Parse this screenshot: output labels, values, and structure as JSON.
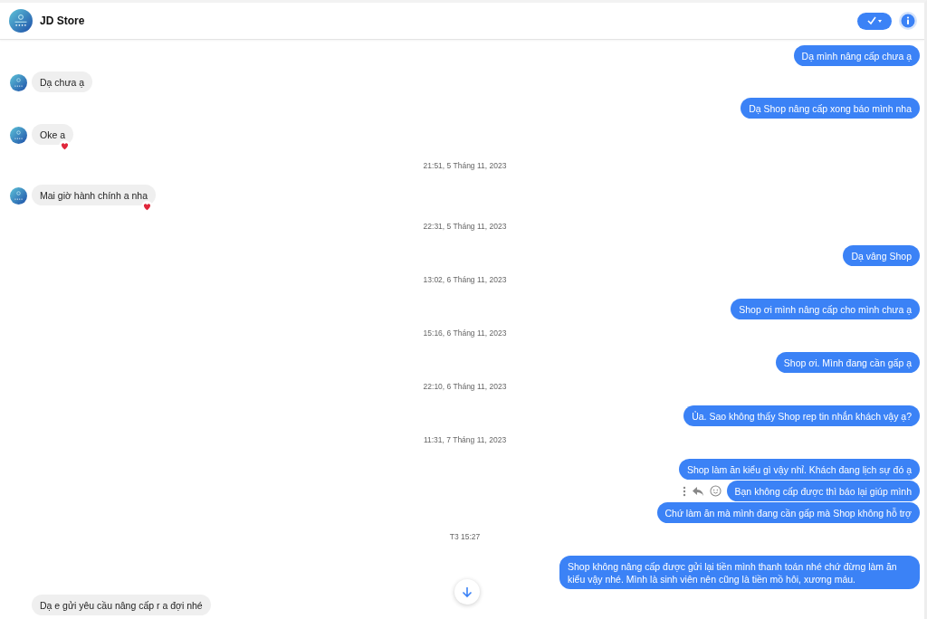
{
  "header": {
    "title": "JD Store"
  },
  "messages": [
    {
      "kind": "outgoing",
      "text": "Dạ mình nâng cấp chưa ạ"
    },
    {
      "kind": "incoming",
      "text": "Dạ chưa ạ",
      "avatar": true,
      "reacted": false
    },
    {
      "kind": "outgoing",
      "text": "Dạ Shop nâng cấp xong báo mình nha"
    },
    {
      "kind": "incoming",
      "text": "Oke a",
      "avatar": true,
      "reacted": true
    },
    {
      "kind": "time",
      "text": "21:51, 5 Tháng 11, 2023"
    },
    {
      "kind": "incoming",
      "text": "Mai giờ hành chính a nha",
      "avatar": true,
      "reacted": true
    },
    {
      "kind": "time",
      "text": "22:31, 5 Tháng 11, 2023"
    },
    {
      "kind": "outgoing",
      "text": "Dạ vâng Shop"
    },
    {
      "kind": "time",
      "text": "13:02, 6 Tháng 11, 2023"
    },
    {
      "kind": "outgoing",
      "text": "Shop ơi mình nâng cấp cho mình chưa ạ"
    },
    {
      "kind": "time",
      "text": "15:16, 6 Tháng 11, 2023"
    },
    {
      "kind": "outgoing",
      "text": "Shop ơi. Mình đang cần gấp ạ"
    },
    {
      "kind": "time",
      "text": "22:10, 6 Tháng 11, 2023"
    },
    {
      "kind": "outgoing",
      "text": "Ủa. Sao không thấy Shop rep tin nhắn khách vậy ạ?"
    },
    {
      "kind": "time",
      "text": "11:31, 7 Tháng 11, 2023"
    },
    {
      "kind": "outgoing",
      "text": "Shop làm ăn kiểu gì vậy nhỉ. Khách đang lịch sự đó ạ"
    },
    {
      "kind": "outgoing",
      "text": "Bạn không cấp được thì báo lại giúp mình",
      "hovered": true
    },
    {
      "kind": "outgoing",
      "text": "Chứ làm ăn mà mình đang cần gấp mà Shop không hỗ trợ"
    },
    {
      "kind": "time",
      "text": "T3 15:27"
    },
    {
      "kind": "outgoing",
      "text": "Shop không nâng cấp được gửi lại tiền mình thanh toán nhé chứ đừng làm ăn kiểu vậy nhé. Mình là sinh viên nên cũng là tiền mồ hôi, xương máu."
    },
    {
      "kind": "incoming",
      "text": "Dạ e gửi yêu cầu nâng cấp r a đợi nhé",
      "avatar": false,
      "reacted": false
    }
  ]
}
